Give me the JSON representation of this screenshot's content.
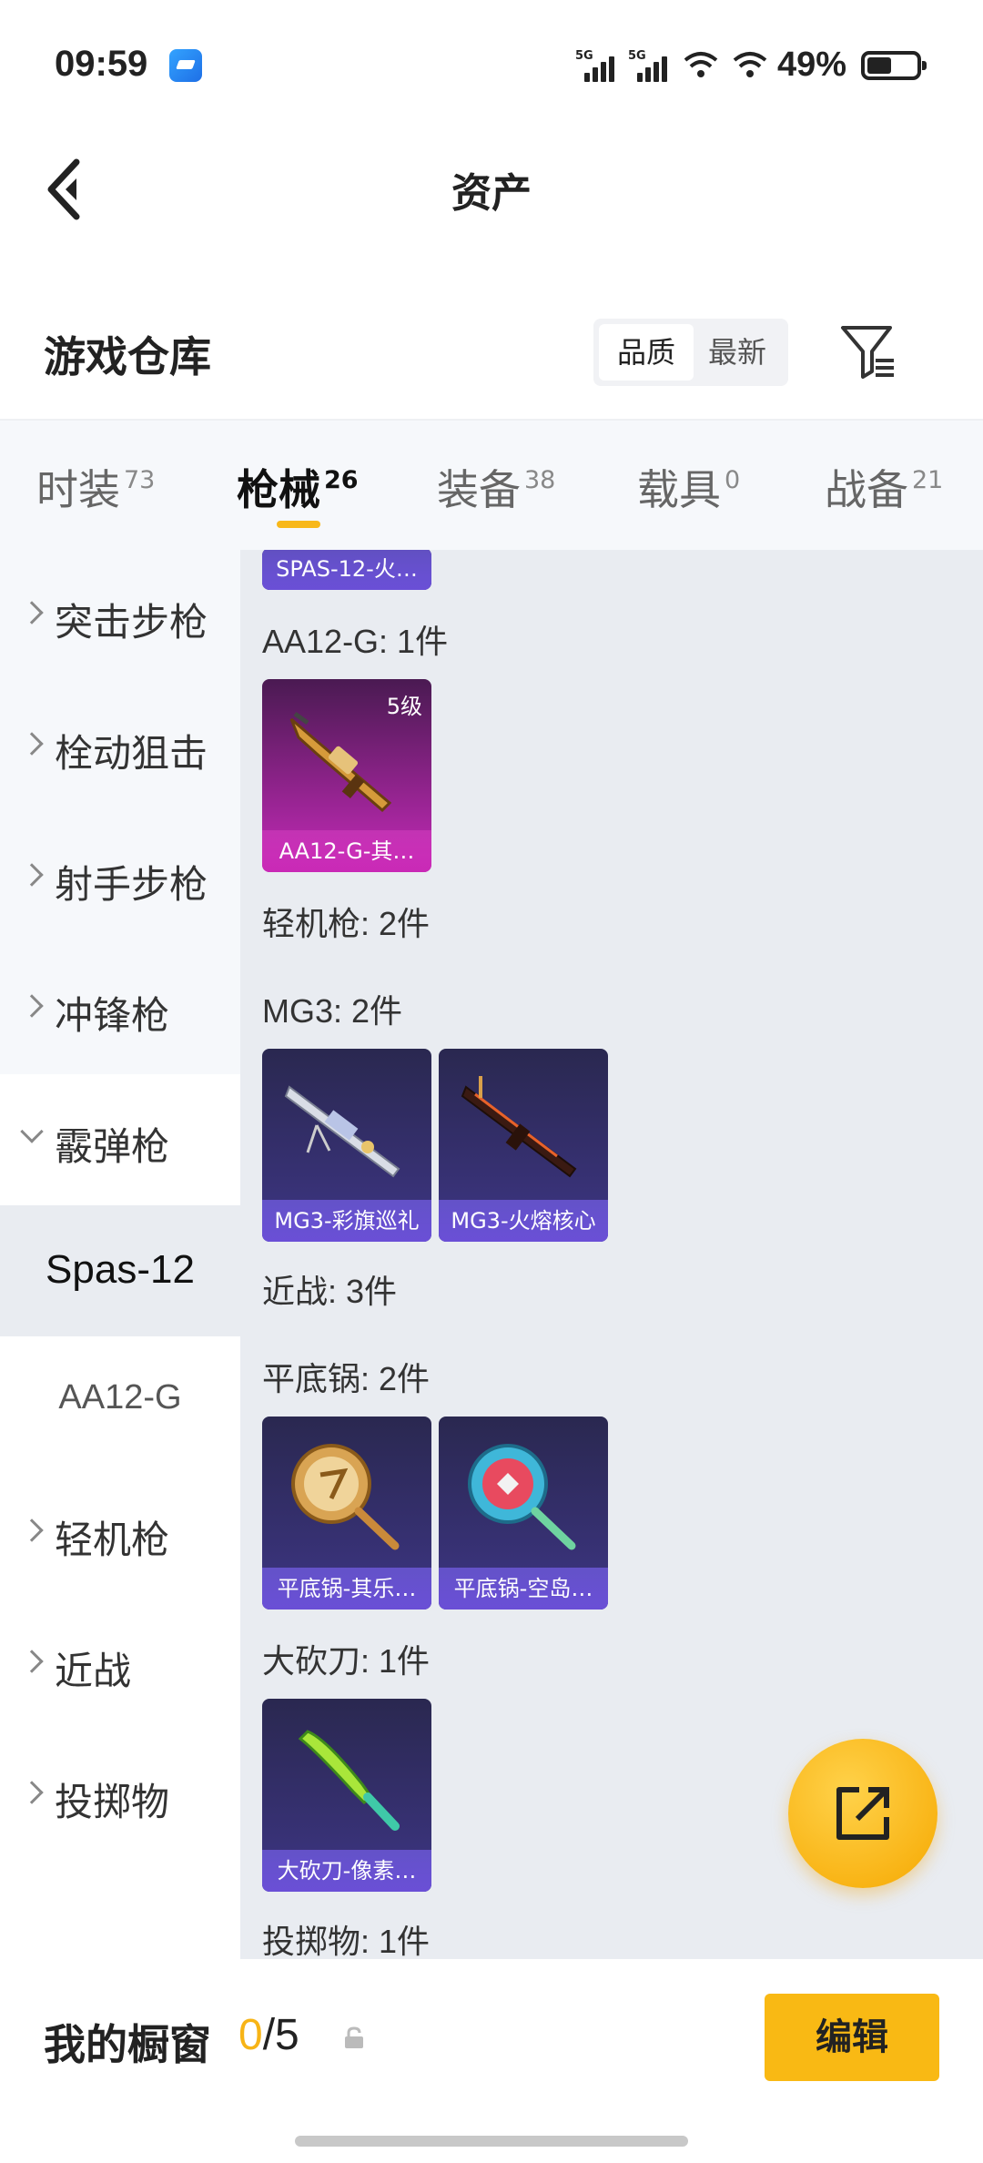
{
  "status": {
    "time": "09:59",
    "sim1": "5G",
    "sim2": "5G",
    "battery": "49%"
  },
  "header": {
    "title": "资产"
  },
  "warehouse": {
    "title": "游戏仓库",
    "sort": [
      "品质",
      "最新"
    ]
  },
  "tabs": [
    {
      "label": "时装",
      "count": "73"
    },
    {
      "label": "枪械",
      "count": "26"
    },
    {
      "label": "装备",
      "count": "38"
    },
    {
      "label": "载具",
      "count": "0"
    },
    {
      "label": "战备",
      "count": "21"
    }
  ],
  "sidebar": {
    "items": [
      {
        "label": "突击步枪"
      },
      {
        "label": "栓动狙击"
      },
      {
        "label": "射手步枪"
      },
      {
        "label": "冲锋枪"
      },
      {
        "label": "霰弹枪"
      },
      {
        "label": "Spas-12"
      },
      {
        "label": "AA12-G"
      },
      {
        "label": "轻机枪"
      },
      {
        "label": "近战"
      },
      {
        "label": "投掷物"
      }
    ]
  },
  "content": {
    "sections": [
      "AA12-G: 1件",
      "轻机枪: 2件",
      "MG3: 2件",
      "近战: 3件",
      "平底锅: 2件",
      "大砍刀: 1件",
      "投掷物: 1件"
    ],
    "cards": [
      {
        "label": "SPAS-12-火…"
      },
      {
        "label": "AA12-G-其…",
        "level": "5级"
      },
      {
        "label": "MG3-彩旗巡礼"
      },
      {
        "label": "MG3-火熔核心"
      },
      {
        "label": "平底锅-其乐…"
      },
      {
        "label": "平底锅-空岛…"
      },
      {
        "label": "大砍刀-像素…"
      }
    ]
  },
  "showcase": {
    "title": "我的橱窗",
    "current": "0",
    "total": "/5",
    "edit_label": "编辑"
  },
  "colors": {
    "accent": "#f9b914",
    "card_purple": "#3d3584",
    "card_pink": "#c52ab8"
  },
  "icons": [
    "back-arrow-icon",
    "filter-icon",
    "share-icon",
    "lock-icon",
    "chevron-right-icon",
    "chevron-down-icon"
  ]
}
